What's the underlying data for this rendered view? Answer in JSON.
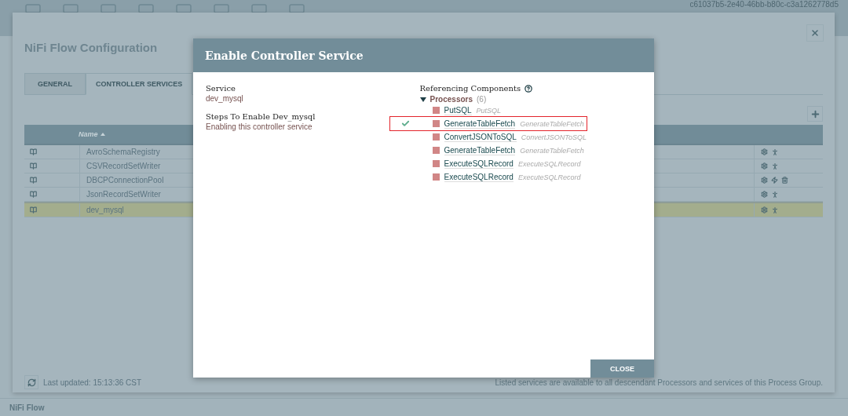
{
  "app_header": {
    "flow_id": "c61037b5-2e40-46bb-b80c-c3a1262778d5"
  },
  "config": {
    "title": "NiFi Flow Configuration",
    "tabs": [
      {
        "label": "GENERAL",
        "selected": false
      },
      {
        "label": "CONTROLLER SERVICES",
        "selected": true
      }
    ],
    "table": {
      "columns": [
        {
          "label": "Name",
          "sorted": true
        }
      ],
      "rows": [
        {
          "name": "AvroSchemaRegistry",
          "selected": false,
          "actions": [
            {
              "kind": "configure"
            },
            {
              "kind": "enable"
            }
          ]
        },
        {
          "name": "CSVRecordSetWriter",
          "selected": false,
          "actions": [
            {
              "kind": "configure"
            },
            {
              "kind": "enable"
            }
          ]
        },
        {
          "name": "DBCPConnectionPool",
          "selected": false,
          "actions": [
            {
              "kind": "configure"
            },
            {
              "kind": "disable"
            },
            {
              "kind": "remove"
            }
          ]
        },
        {
          "name": "JsonRecordSetWriter",
          "selected": false,
          "actions": [
            {
              "kind": "configure"
            },
            {
              "kind": "enable"
            }
          ]
        },
        {
          "name": "dev_mysql",
          "selected": true,
          "actions": [
            {
              "kind": "configure"
            },
            {
              "kind": "enable"
            }
          ]
        }
      ]
    },
    "last_updated": "Last updated: 15:13:36 CST",
    "footer_note": "Listed services are available to all descendant Processors and services of this Process Group."
  },
  "breadcrumb": "NiFi Flow",
  "dialog": {
    "title": "Enable Controller Service",
    "service_label": "Service",
    "service_name": "dev_mysql",
    "steps_label": "Steps To Enable Dev_mysql",
    "steps": [
      {
        "text": "Enabling this controller service"
      }
    ],
    "referencing": {
      "label": "Referencing Components",
      "group": {
        "label": "Processors",
        "count": "(6)",
        "expanded": true,
        "items": [
          {
            "name": "PutSQL",
            "type": "PutSQL",
            "done": false,
            "highlighted": false
          },
          {
            "name": "GenerateTableFetch",
            "type": "GenerateTableFetch",
            "done": true,
            "highlighted": true
          },
          {
            "name": "ConvertJSONToSQL",
            "type": "ConvertJSONToSQL",
            "done": false,
            "highlighted": false
          },
          {
            "name": "GenerateTableFetch",
            "type": "GenerateTableFetch",
            "done": false,
            "highlighted": false
          },
          {
            "name": "ExecuteSQLRecord",
            "type": "ExecuteSQLRecord",
            "done": false,
            "highlighted": false
          },
          {
            "name": "ExecuteSQLRecord",
            "type": "ExecuteSQLRecord",
            "done": false,
            "highlighted": false
          }
        ]
      }
    },
    "close": "CLOSE"
  }
}
